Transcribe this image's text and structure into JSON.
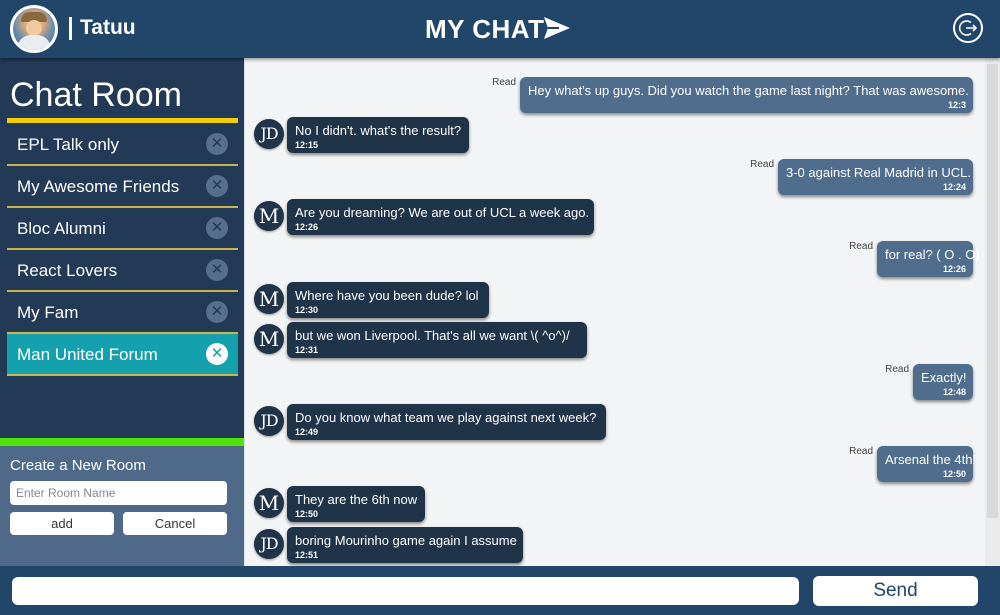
{
  "header": {
    "username": "Tatuu",
    "app_title": "MY CHAT",
    "logo_icon": "paper-plane-icon",
    "logout_icon": "logout-icon"
  },
  "sidebar": {
    "title": "Chat Room",
    "rooms": [
      {
        "name": "EPL Talk only",
        "active": false
      },
      {
        "name": "My Awesome Friends",
        "active": false
      },
      {
        "name": "Bloc Alumni",
        "active": false
      },
      {
        "name": "React Lovers",
        "active": false
      },
      {
        "name": "My Fam",
        "active": false
      },
      {
        "name": "Man United Forum",
        "active": true
      }
    ],
    "close_symbol": "✕",
    "create_room": {
      "label": "Create a New Room",
      "placeholder": "Enter Room Name",
      "add_label": "add",
      "cancel_label": "Cancel"
    }
  },
  "messages": [
    {
      "direction": "out",
      "text": "Hey what's up guys. Did you watch the game last night? That was awesome.",
      "time": "12:3",
      "status": "Read"
    },
    {
      "direction": "in",
      "avatar": "JD",
      "text": "No I didn't. what's the result?",
      "time": "12:15"
    },
    {
      "direction": "out",
      "text": "3-0 against Real Madrid in UCL.",
      "time": "12:24",
      "status": "Read"
    },
    {
      "direction": "in",
      "avatar": "M",
      "text": "Are you dreaming? We are out of UCL a week ago.",
      "time": "12:26"
    },
    {
      "direction": "out",
      "text": "for real? ( O . O)",
      "time": "12:26",
      "status": "Read"
    },
    {
      "direction": "in",
      "avatar": "M",
      "text": "Where have you been dude? lol",
      "time": "12:30"
    },
    {
      "direction": "in",
      "avatar": "M",
      "text": "but we won Liverpool. That's all we want \\( ^o^)/",
      "time": "12:31"
    },
    {
      "direction": "out",
      "text": "Exactly!",
      "time": "12:48",
      "status": "Read"
    },
    {
      "direction": "in",
      "avatar": "JD",
      "text": "Do you know what team we play against next week?",
      "time": "12:49"
    },
    {
      "direction": "out",
      "text": "Arsenal the 4th!",
      "time": "12:50",
      "status": "Read"
    },
    {
      "direction": "in",
      "avatar": "M",
      "text": "They are the 6th now",
      "time": "12:50"
    },
    {
      "direction": "in",
      "avatar": "JD",
      "text": "boring Mourinho game again I assume",
      "time": "12:51"
    }
  ],
  "composer": {
    "value": "",
    "send_label": "Send"
  },
  "colors": {
    "header": "#21466a",
    "sidebar": "#223a55",
    "active_room": "#15a0ad",
    "title_underline": "#f2d000",
    "green_bar": "#52e20b",
    "outgoing_bubble": "#506d8e",
    "incoming_bubble": "#1f3349"
  }
}
